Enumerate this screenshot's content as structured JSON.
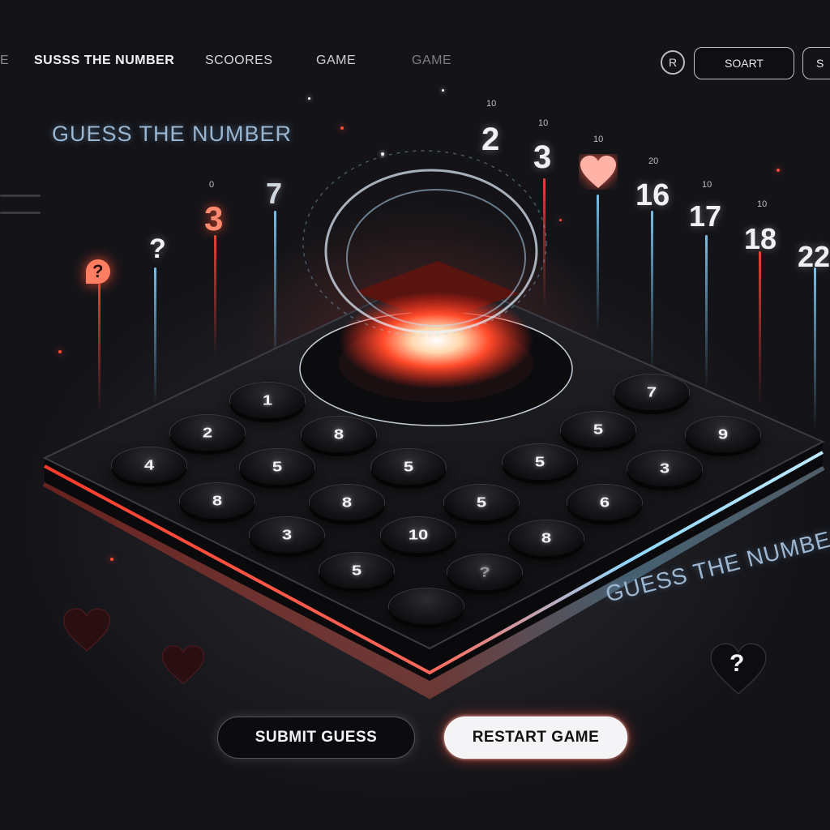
{
  "nav": {
    "edge_text": "E",
    "brand": "SUSSS THE NUMBER",
    "scores": "SCOORES",
    "game": "GAME",
    "game_secondary": "GAME",
    "circle_label": "R",
    "start_button": "SOART",
    "cut_button": "S"
  },
  "heading": {
    "main": "GUESS THE NUMBER",
    "side": "GUESS THE NUMBER"
  },
  "floating_numbers": {
    "n0": "0",
    "n1": "?",
    "n2": "3",
    "n3": "7",
    "n4": "10",
    "n5": "2",
    "n6": "10",
    "n7": "3",
    "n8": "10",
    "n9": "16",
    "n10": "20",
    "n11": "17",
    "n12": "10",
    "n13": "18",
    "n14": "10",
    "n15": "22",
    "n16": "?"
  },
  "keypad": {
    "keys": [
      "1",
      "7",
      "2",
      "8",
      "5",
      "9",
      "4",
      "5",
      "5",
      "5",
      "3",
      "8",
      "8",
      "5",
      "6",
      "3",
      "10",
      "8",
      "5",
      "?",
      ""
    ]
  },
  "buttons": {
    "submit": "SUBMIT GUESS",
    "restart": "RESTART GAME"
  },
  "heart_badge": "?",
  "colors": {
    "accent_red": "#ff4a3a",
    "accent_cyan": "#82d2ff",
    "background": "#131316"
  }
}
